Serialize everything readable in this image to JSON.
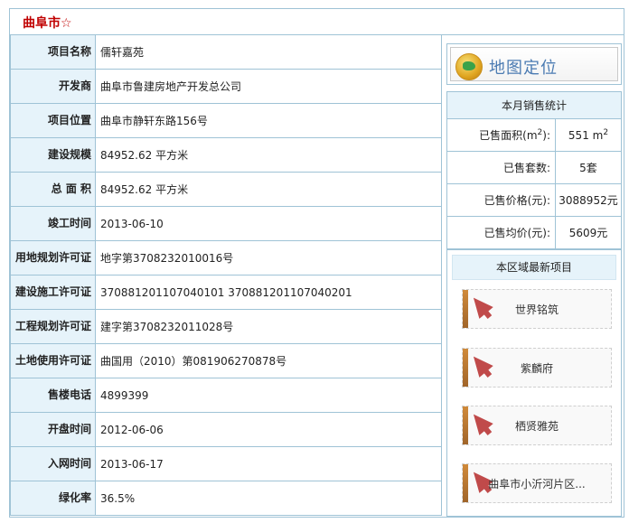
{
  "header": {
    "title": "曲阜市☆"
  },
  "info_rows": [
    {
      "label": "项目名称",
      "value": "儒轩嘉苑"
    },
    {
      "label": "开发商",
      "value": "曲阜市鲁建房地产开发总公司"
    },
    {
      "label": "项目位置",
      "value": "曲阜市静轩东路156号"
    },
    {
      "label": "建设规模",
      "value": "84952.62 平方米"
    },
    {
      "label": "总 面 积",
      "value": "84952.62 平方米"
    },
    {
      "label": "竣工时间",
      "value": "2013-06-10"
    },
    {
      "label": "用地规划许可证",
      "value": "地字第3708232010016号"
    },
    {
      "label": "建设施工许可证",
      "value": "370881201107040101 370881201107040201"
    },
    {
      "label": "工程规划许可证",
      "value": "建字第3708232011028号"
    },
    {
      "label": "土地使用许可证",
      "value": "曲国用（2010）第081906270878号"
    },
    {
      "label": "售楼电话",
      "value": "4899399"
    },
    {
      "label": "开盘时间",
      "value": "2012-06-06"
    },
    {
      "label": "入网时间",
      "value": "2013-06-17"
    },
    {
      "label": "绿化率",
      "value": "36.5%"
    }
  ],
  "map_button": {
    "label": "地图定位",
    "icon": "globe-icon"
  },
  "stats": {
    "title": "本月销售统计",
    "area_label_prefix": "已售面积(m",
    "area_label_sup": "2",
    "area_label_suffix": "):",
    "area_value_prefix": "551 m",
    "area_value_sup": "2",
    "units_label": "已售套数:",
    "units_value": "5套",
    "price_label": "已售价格(元):",
    "price_value": "3088952元",
    "avg_label": "已售均价(元):",
    "avg_value": "5609元"
  },
  "projects": {
    "title": "本区域最新项目",
    "items": [
      {
        "name": "世界铭筑"
      },
      {
        "name": "紫麟府"
      },
      {
        "name": "栖贤雅苑"
      },
      {
        "name": "曲阜市小沂河片区..."
      }
    ]
  }
}
